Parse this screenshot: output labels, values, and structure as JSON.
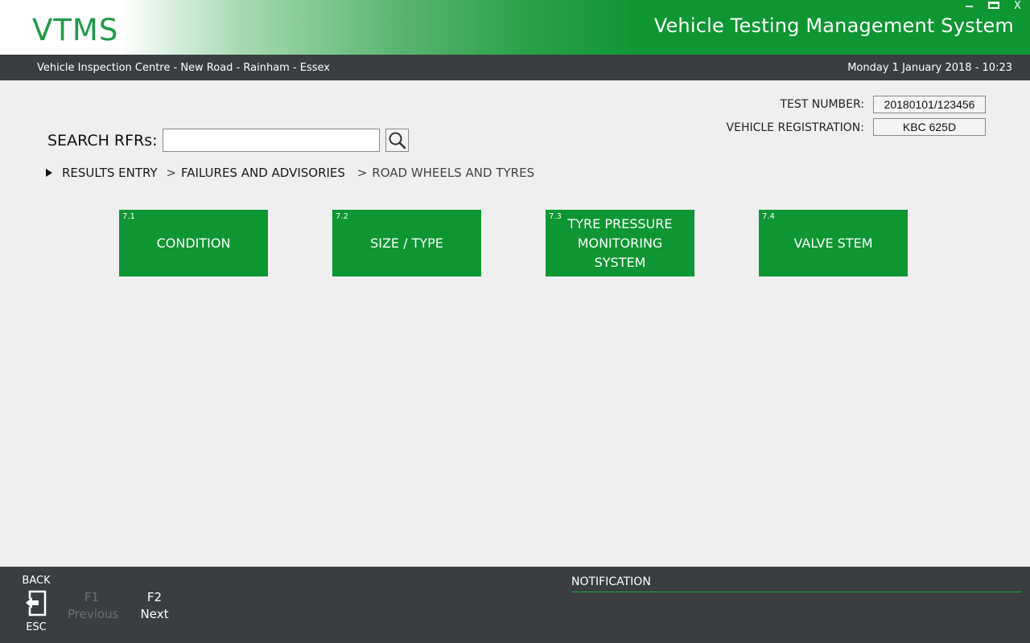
{
  "header": {
    "logo": "VTMS",
    "title": "Vehicle Testing Management System",
    "controls": {
      "minimize": "minimize-icon",
      "maximize": "maximize-icon",
      "close": "X"
    }
  },
  "infobar": {
    "location": "Vehicle Inspection Centre - New Road - Rainham - Essex",
    "datetime": "Monday 1 January 2018 - 10:23"
  },
  "test": {
    "test_number_label": "TEST NUMBER:",
    "test_number": "20180101/123456",
    "registration_label": "VEHICLE REGISTRATION:",
    "registration": "KBC 625D"
  },
  "search": {
    "label": "SEARCH RFRs:",
    "value": "",
    "placeholder": "",
    "icon": "search-icon"
  },
  "breadcrumb": {
    "items": [
      "RESULTS ENTRY",
      "FAILURES AND ADVISORIES"
    ],
    "current": "ROAD WHEELS AND TYRES",
    "separator": ">"
  },
  "tiles": [
    {
      "number": "7.1",
      "label": "CONDITION"
    },
    {
      "number": "7.2",
      "label": "SIZE / TYPE"
    },
    {
      "number": "7.3",
      "label": "TYRE PRESSURE MONITORING SYSTEM"
    },
    {
      "number": "7.4",
      "label": "VALVE STEM"
    }
  ],
  "footer": {
    "back": {
      "label": "BACK",
      "key": "ESC",
      "icon": "exit-icon"
    },
    "previous": {
      "key": "F1",
      "label": "Previous",
      "enabled": false
    },
    "next": {
      "key": "F2",
      "label": "Next",
      "enabled": true
    },
    "notification_label": "NOTIFICATION"
  },
  "colors": {
    "accent_green": "#0d9632",
    "bar_dark": "#3a3e41",
    "background": "#efefef"
  }
}
